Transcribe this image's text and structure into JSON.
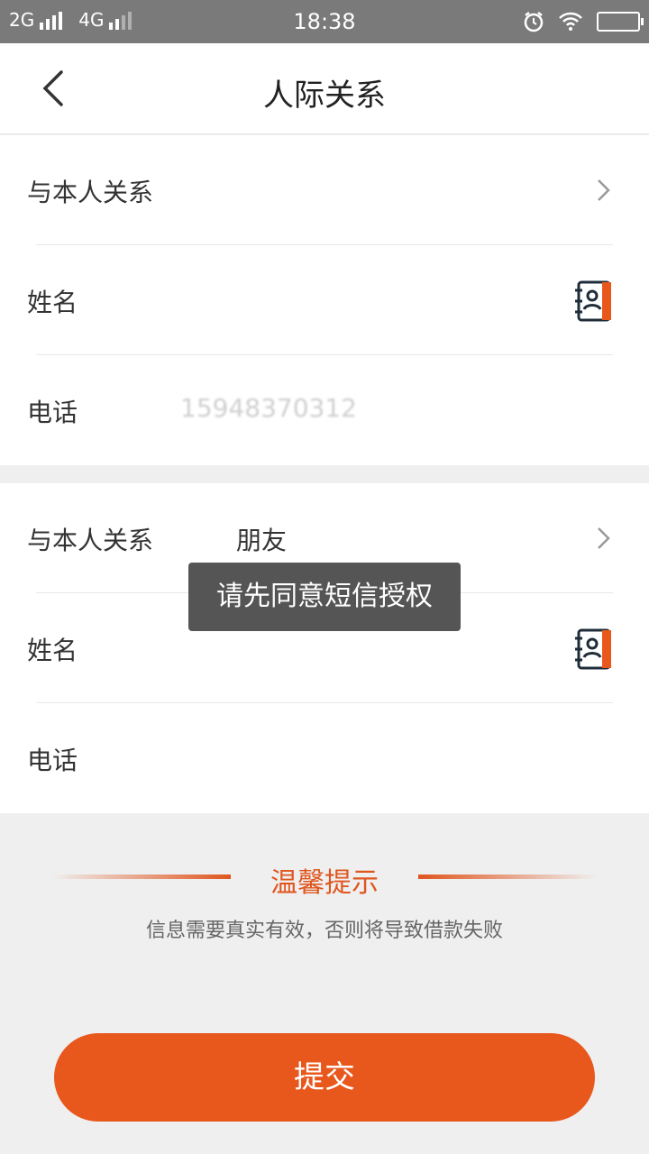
{
  "status_bar": {
    "network_left": "2G",
    "network_right": "4G",
    "time": "18:38"
  },
  "header": {
    "title": "人际关系",
    "back_icon": "chevron-left-icon"
  },
  "contact1": {
    "relation_label": "与本人关系",
    "relation_value": "",
    "name_label": "姓名",
    "name_value": "",
    "phone_label": "电话",
    "phone_value": "15948370312"
  },
  "contact2": {
    "relation_label": "与本人关系",
    "relation_value": "朋友",
    "name_label": "姓名",
    "name_value": "",
    "phone_label": "电话",
    "phone_value": ""
  },
  "toast": {
    "text": "请先同意短信授权"
  },
  "tip": {
    "title": "温馨提示",
    "note": "信息需要真实有效，否则将导致借款失败"
  },
  "submit": {
    "label": "提交"
  },
  "colors": {
    "accent": "#e8571c",
    "icon_dark": "#1f2d3a"
  }
}
